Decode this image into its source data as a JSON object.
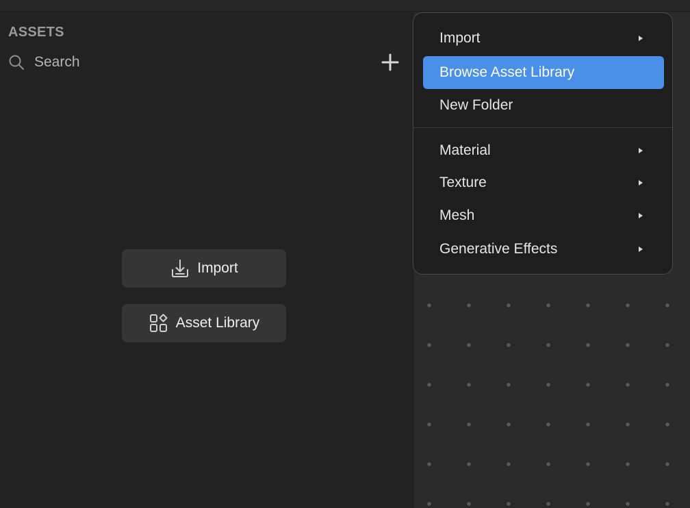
{
  "assets_panel": {
    "title": "ASSETS",
    "search": {
      "label": "Search",
      "icon": "search-icon"
    },
    "add_icon": "plus-icon",
    "import_button": {
      "label": "Import",
      "icon": "import-icon"
    },
    "asset_library_button": {
      "label": "Asset Library",
      "icon": "asset-library-icon"
    }
  },
  "context_menu": {
    "highlighted_item": "Browse Asset Library",
    "items": [
      {
        "label": "Import",
        "has_submenu": true
      },
      {
        "label": "Browse Asset Library",
        "has_submenu": false
      },
      {
        "label": "New Folder",
        "has_submenu": false
      },
      {
        "label": "Material",
        "has_submenu": true
      },
      {
        "label": "Texture",
        "has_submenu": true
      },
      {
        "label": "Mesh",
        "has_submenu": true
      },
      {
        "label": "Generative Effects",
        "has_submenu": true
      }
    ]
  },
  "colors": {
    "panel_background": "#222222",
    "canvas_background": "#2a2a2a",
    "menu_background": "#1e1e1e",
    "highlight": "#4a90e8",
    "button_background": "#353535",
    "title_text": "#9a9a9a"
  }
}
